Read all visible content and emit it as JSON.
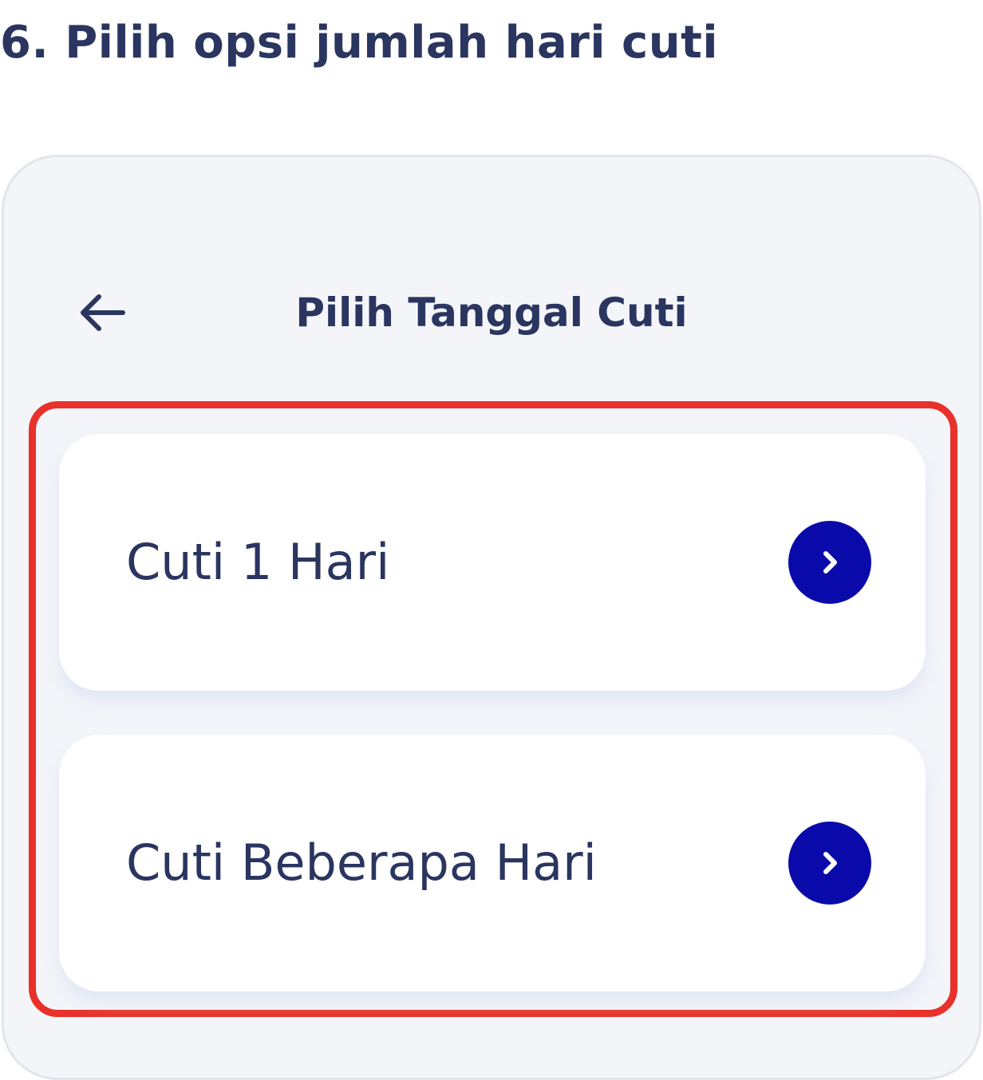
{
  "heading": "6.  Pilih opsi jumlah hari cuti",
  "screen": {
    "back_icon": "arrow-left-icon",
    "title": "Pilih Tanggal Cuti"
  },
  "options": [
    {
      "label": "Cuti 1 Hari",
      "icon": "chevron-right-icon"
    },
    {
      "label": "Cuti Beberapa Hari",
      "icon": "chevron-right-icon"
    }
  ],
  "colors": {
    "text": "#2a3560",
    "accent": "#0a0aaa",
    "highlight": "#e8312a",
    "screen_bg": "#f4f5f9"
  }
}
